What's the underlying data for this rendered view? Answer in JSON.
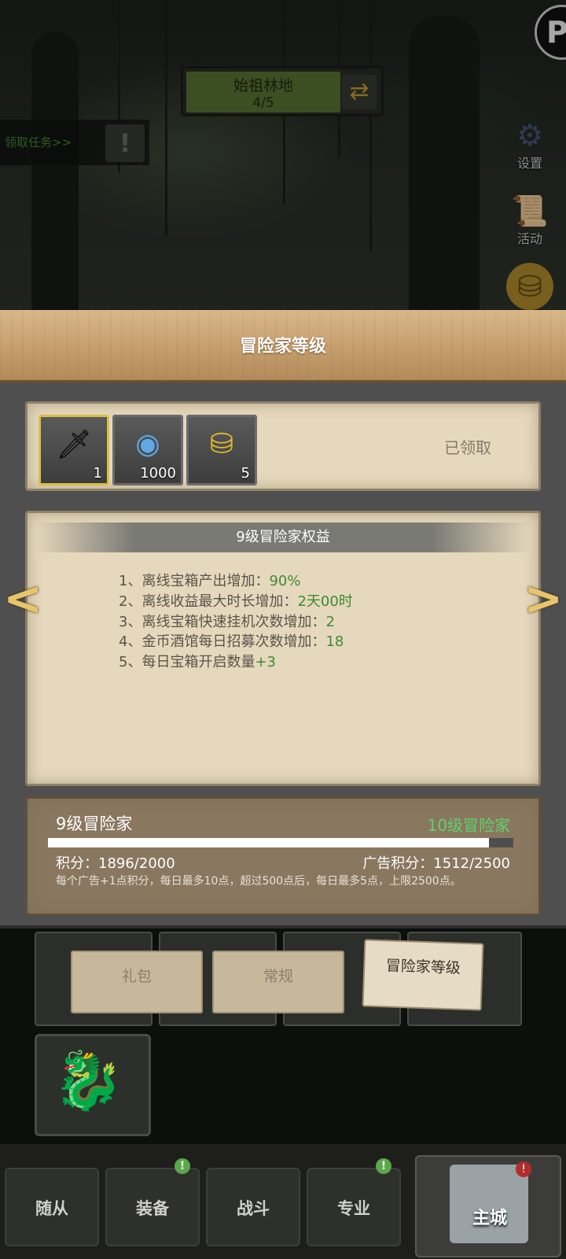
{
  "map": {
    "name": "始祖林地",
    "progress": "4/5"
  },
  "quest": {
    "link": "领取任务>>"
  },
  "side_menu": [
    {
      "label": "设置",
      "icon": "gear-icon"
    },
    {
      "label": "活动",
      "icon": "scroll-icon"
    },
    {
      "label": "",
      "icon": "treasure-icon"
    }
  ],
  "modal": {
    "title": "冒险家等级",
    "rewards": [
      {
        "icon": "dagger-icon",
        "count": "1"
      },
      {
        "icon": "gem-ring-icon",
        "count": "1000"
      },
      {
        "icon": "gold-coin-icon",
        "count": "5"
      }
    ],
    "reward_status": "已领取",
    "benefits_title": "9级冒险家权益",
    "benefits": [
      {
        "text": "1、离线宝箱产出增加：",
        "value": "90%"
      },
      {
        "text": "2、离线收益最大时长增加：",
        "value": "2天00时"
      },
      {
        "text": "3、离线宝箱快速挂机次数增加：",
        "value": "2"
      },
      {
        "text": "4、金币酒馆每日招募次数增加：",
        "value": "18"
      },
      {
        "text": "5、每日宝箱开启数量",
        "value": "+3"
      }
    ],
    "current_level": "9级冒险家",
    "next_level": "10级冒险家",
    "progress_fraction": 0.948,
    "score": "积分：1896/2000",
    "ad_score": "广告积分：1512/2500",
    "note": "每个广告+1点积分，每日最多10点，超过500点后，每日最多5点，上限2500点。"
  },
  "tabs": [
    {
      "label": "礼包",
      "active": false
    },
    {
      "label": "常规",
      "active": false
    },
    {
      "label": "冒险家等级",
      "active": true
    }
  ],
  "bottom_nav": [
    {
      "label": "随从",
      "badge": ""
    },
    {
      "label": "装备",
      "badge": "!"
    },
    {
      "label": "战斗",
      "badge": ""
    },
    {
      "label": "专业",
      "badge": "!"
    },
    {
      "label": "主城",
      "badge": "!"
    }
  ],
  "colors": {
    "accent_green": "#3f8a34",
    "next_level_green": "#5fd26a",
    "header_wood": "#c49c6b"
  }
}
